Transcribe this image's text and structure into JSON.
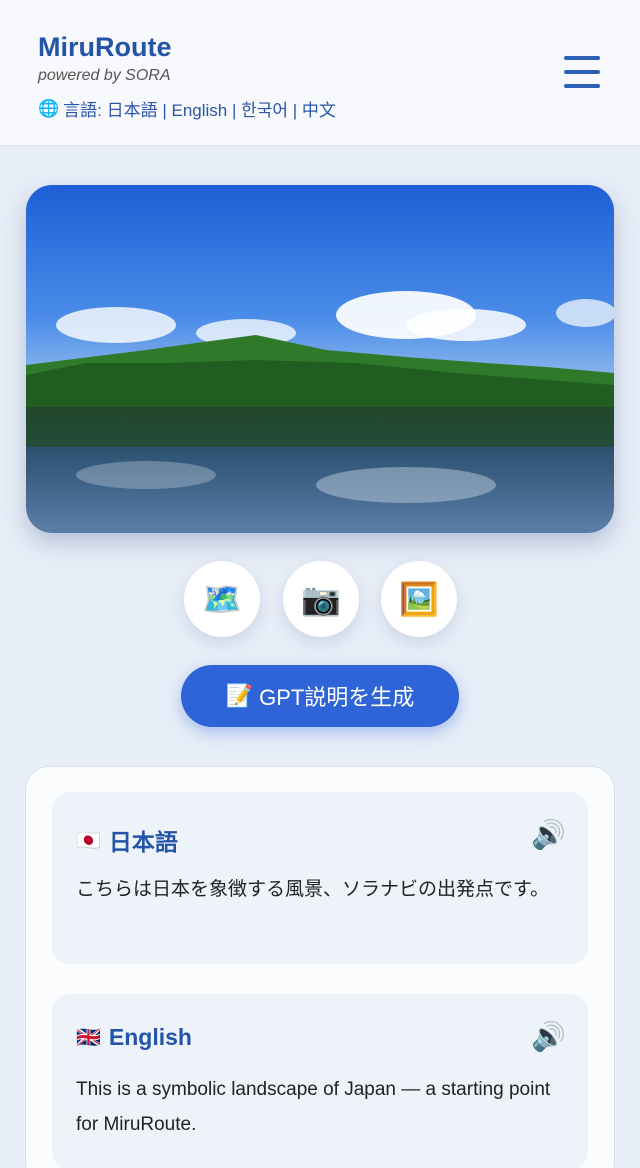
{
  "header": {
    "brand": "MiruRoute",
    "powered": "powered by SORA",
    "lang_label": "言語: 日本語 | English | 한국어 | 中文"
  },
  "actions": {
    "map_icon": "🗺️",
    "camera_icon": "📷",
    "image_icon": "🖼️",
    "gpt_button_icon": "📝",
    "gpt_button_label": "GPT説明を生成"
  },
  "descriptions": [
    {
      "flag": "🇯🇵",
      "language": "日本語",
      "text": "こちらは日本を象徴する風景、ソラナビの出発点です。",
      "speaker": "🔊"
    },
    {
      "flag": "🇬🇧",
      "language": "English",
      "text": "This is a symbolic landscape of Japan — a starting point for MiruRoute.",
      "speaker": "🔊"
    }
  ],
  "colors": {
    "accent": "#2f63d8",
    "brand": "#2454a8",
    "background": "#e8eef8"
  }
}
